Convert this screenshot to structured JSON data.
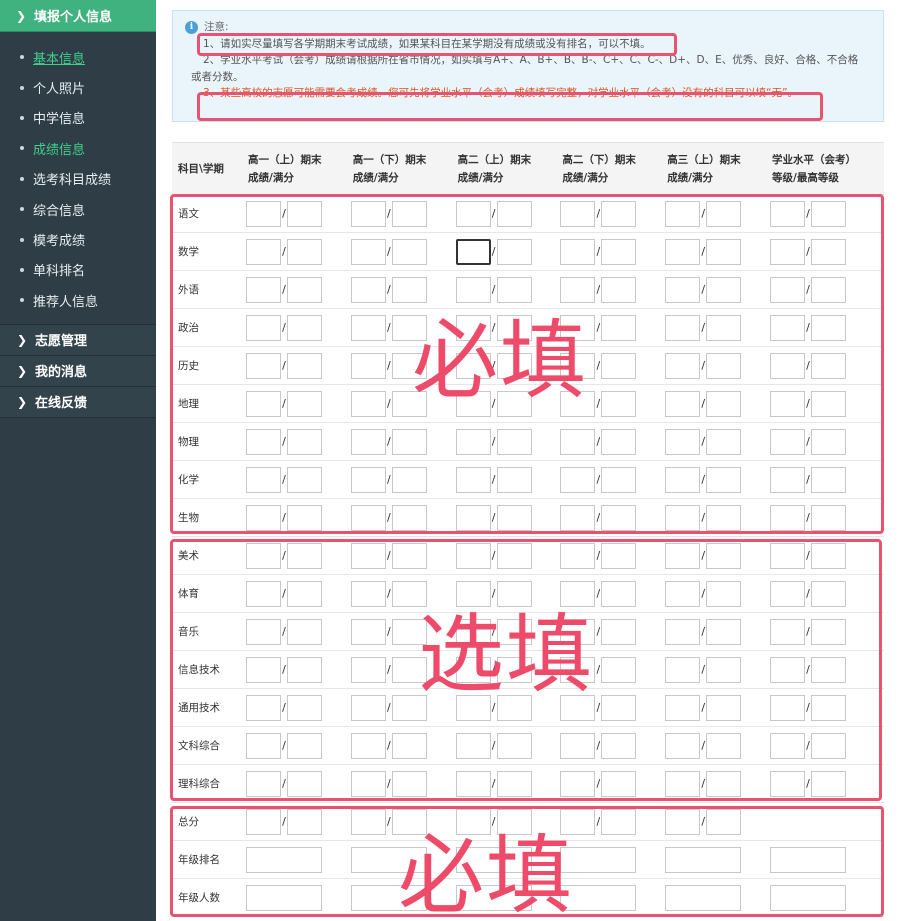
{
  "sidebar": {
    "header": "填报个人信息",
    "items": [
      {
        "label": "基本信息"
      },
      {
        "label": "个人照片"
      },
      {
        "label": "中学信息"
      },
      {
        "label": "成绩信息"
      },
      {
        "label": "选考科目成绩"
      },
      {
        "label": "综合信息"
      },
      {
        "label": "模考成绩"
      },
      {
        "label": "单科排名"
      },
      {
        "label": "推荐人信息"
      }
    ],
    "groups": [
      {
        "label": "志愿管理"
      },
      {
        "label": "我的消息"
      },
      {
        "label": "在线反馈"
      }
    ]
  },
  "notice": {
    "title": "注意:",
    "line1": "1、请如实尽量填写各学期期末考试成绩，如果某科目在某学期没有成绩或没有排名，可以不填。",
    "line2a": "2、学业水平考试（会考）成绩请根据所在省市情况，如实填写A+、A、B+、B、B-、C+、C、C-、D+、D、E、优秀、良好、合格、不合格",
    "line2b": "或者分数。",
    "line3": "3、某些高校的志愿可能需要会考成绩。您可先将学业水平（会考）成绩填写完整，对学业水平（会考）没有的科目可以填“无”。"
  },
  "table": {
    "header_subject": "科目\\学期",
    "columns": [
      {
        "line1": "高一（上）期末",
        "line2": "成绩/满分"
      },
      {
        "line1": "高一（下）期末",
        "line2": "成绩/满分"
      },
      {
        "line1": "高二（上）期末",
        "line2": "成绩/满分"
      },
      {
        "line1": "高二（下）期末",
        "line2": "成绩/满分"
      },
      {
        "line1": "高三（上）期末",
        "line2": "成绩/满分"
      },
      {
        "line1": "学业水平（会考）",
        "line2": "等级/最高等级"
      }
    ],
    "required_subjects": [
      "语文",
      "数学",
      "外语",
      "政治",
      "历史",
      "地理",
      "物理",
      "化学",
      "生物"
    ],
    "optional_subjects": [
      "美术",
      "体育",
      "音乐",
      "信息技术",
      "通用技术",
      "文科综合",
      "理科综合"
    ],
    "summary_rows": [
      "总分",
      "年级排名",
      "年级人数"
    ],
    "slash": "/"
  },
  "annotations": {
    "required_label": "必填",
    "optional_label": "选填",
    "required_label_2": "必填"
  },
  "colors": {
    "sidebar_bg": "#2f3e46",
    "sidebar_header": "#3fb27f",
    "active_item": "#3fd08d",
    "annotation_red": "#e8546f",
    "warning_text": "#d9541e"
  }
}
